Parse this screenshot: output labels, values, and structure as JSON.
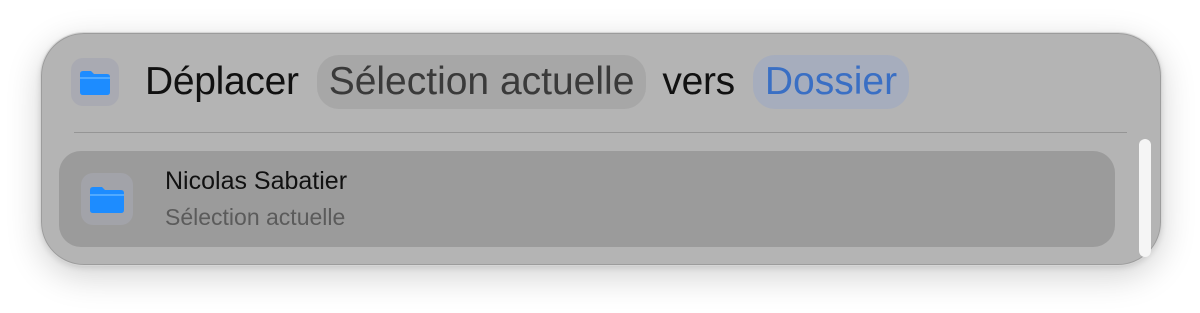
{
  "header": {
    "verb": "Déplacer",
    "selection_token": "Sélection actuelle",
    "connector": "vers",
    "destination_token": "Dossier",
    "icon": "folder-icon"
  },
  "results": [
    {
      "title": "Nicolas Sabatier",
      "subtitle": "Sélection actuelle",
      "icon": "folder-icon"
    }
  ],
  "colors": {
    "folder_blue": "#1d8cff",
    "token_link": "#3a6fc4"
  }
}
